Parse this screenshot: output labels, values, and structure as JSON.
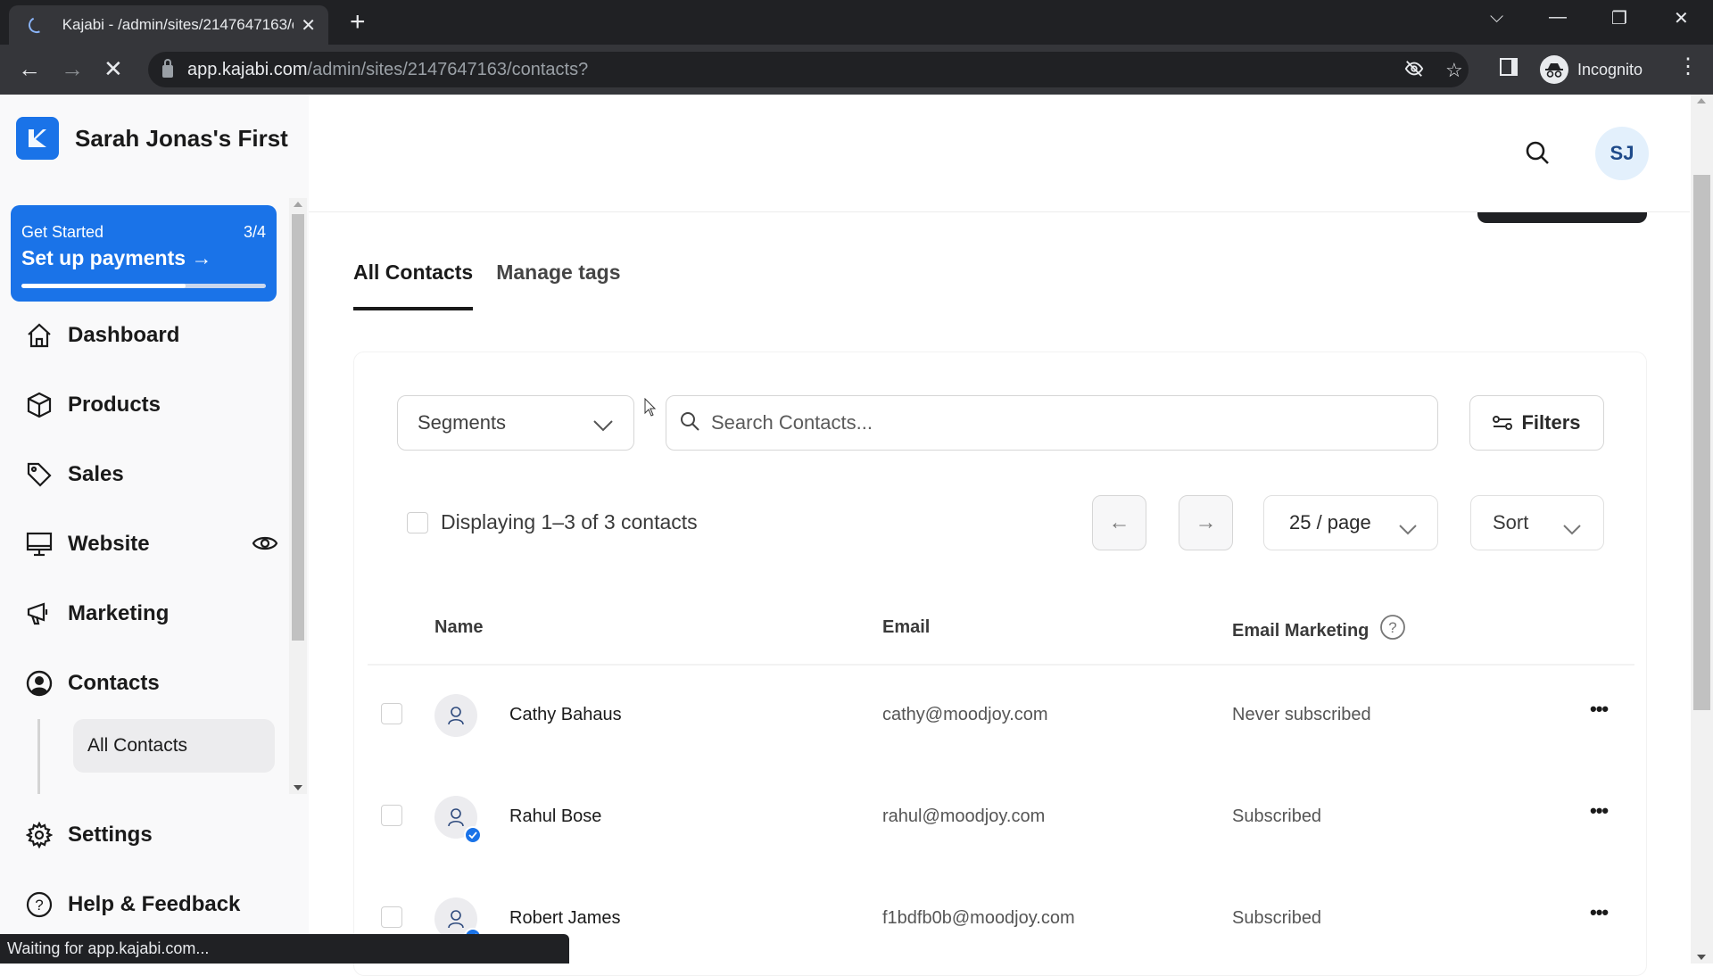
{
  "browser": {
    "tab_title": "Kajabi - /admin/sites/2147647163/contacts?",
    "url_host": "app.kajabi.com",
    "url_path": "/admin/sites/2147647163/contacts?",
    "profile_label": "Incognito",
    "status_text": "Waiting for app.kajabi.com..."
  },
  "sidebar": {
    "brand_name": "Sarah Jonas's First",
    "get_started": {
      "label": "Get Started",
      "count": "3/4",
      "title": "Set up payments",
      "progress": 0.67
    },
    "items": [
      {
        "label": "Dashboard",
        "icon": "home-icon"
      },
      {
        "label": "Products",
        "icon": "box-icon"
      },
      {
        "label": "Sales",
        "icon": "tag-icon"
      },
      {
        "label": "Website",
        "icon": "monitor-icon"
      },
      {
        "label": "Marketing",
        "icon": "megaphone-icon"
      },
      {
        "label": "Contacts",
        "icon": "user-circle-icon"
      },
      {
        "label": "Settings",
        "icon": "gear-icon"
      },
      {
        "label": "Help & Feedback",
        "icon": "help-circle-icon"
      }
    ],
    "sub_items": [
      {
        "label": "All Contacts"
      }
    ]
  },
  "header": {
    "avatar_initials": "SJ"
  },
  "tabs": [
    {
      "label": "All Contacts",
      "active": true
    },
    {
      "label": "Manage tags",
      "active": false
    }
  ],
  "toolbar": {
    "segments_label": "Segments",
    "search_placeholder": "Search Contacts...",
    "search_value": "",
    "filters_label": "Filters",
    "display_text": "Displaying 1–3 of 3 contacts",
    "per_page": "25 / page",
    "sort_label": "Sort"
  },
  "table": {
    "columns": [
      "Name",
      "Email",
      "Email Marketing"
    ],
    "rows": [
      {
        "name": "Cathy Bahaus",
        "email": "cathy@moodjoy.com",
        "status": "Never subscribed",
        "verified": false
      },
      {
        "name": "Rahul Bose",
        "email": "rahul@moodjoy.com",
        "status": "Subscribed",
        "verified": true
      },
      {
        "name": "Robert James",
        "email": "f1bdfb0b@moodjoy.com",
        "status": "Subscribed",
        "verified": true
      }
    ]
  },
  "colors": {
    "brand": "#1a73e8",
    "avatar_bg": "#e3f0fc",
    "avatar_text": "#1e4a8a"
  }
}
